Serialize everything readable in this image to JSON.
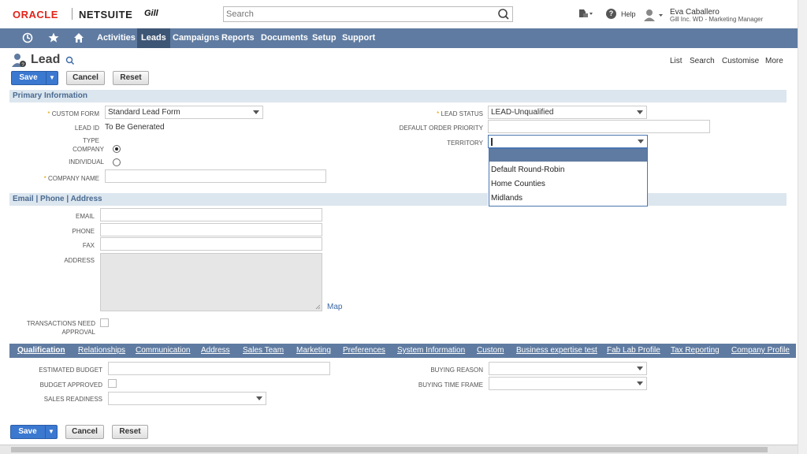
{
  "header": {
    "logo_oracle": "ORACLE",
    "logo_netsuite": "NETSUITE",
    "logo_company": "Gill",
    "search_placeholder": "Search",
    "help_label": "Help",
    "user_name": "Eva Caballero",
    "user_role": "Gill Inc. WD - Marketing Manager"
  },
  "nav": {
    "items": [
      "Activities",
      "Leads",
      "Campaigns",
      "Reports",
      "Documents",
      "Setup",
      "Support"
    ],
    "active": "Leads"
  },
  "page": {
    "title": "Lead",
    "links": [
      "List",
      "Search",
      "Customise",
      "More"
    ]
  },
  "buttons": {
    "save": "Save",
    "cancel": "Cancel",
    "reset": "Reset"
  },
  "primary": {
    "section_title": "Primary Information",
    "custom_form_label": "CUSTOM FORM",
    "custom_form_value": "Standard Lead Form",
    "lead_id_label": "LEAD ID",
    "lead_id_value": "To Be Generated",
    "type_label": "TYPE",
    "company_label": "COMPANY",
    "individual_label": "INDIVIDUAL",
    "company_name_label": "COMPANY NAME",
    "lead_status_label": "LEAD STATUS",
    "lead_status_value": "LEAD-Unqualified",
    "default_order_priority_label": "DEFAULT ORDER PRIORITY",
    "territory_label": "TERRITORY",
    "territory_options": [
      "Default Round-Robin",
      "Home Counties",
      "Midlands"
    ]
  },
  "contact": {
    "section_title": "Email | Phone | Address",
    "email_label": "EMAIL",
    "phone_label": "PHONE",
    "fax_label": "FAX",
    "address_label": "ADDRESS",
    "map_link": "Map",
    "transactions_label_1": "TRANSACTIONS NEED",
    "transactions_label_2": "APPROVAL"
  },
  "subtabs": [
    "Qualification",
    "Relationships",
    "Communication",
    "Address",
    "Sales Team",
    "Marketing",
    "Preferences",
    "System Information",
    "Custom",
    "Business expertise test",
    "Fab Lab Profile",
    "Tax Reporting",
    "Company Profile"
  ],
  "qualification": {
    "estimated_budget_label": "ESTIMATED BUDGET",
    "budget_approved_label": "BUDGET APPROVED",
    "sales_readiness_label": "SALES READINESS",
    "buying_reason_label": "BUYING REASON",
    "buying_time_frame_label": "BUYING TIME FRAME"
  },
  "colors": {
    "nav_bg": "#5f7ba1",
    "nav_active": "#3e5675",
    "section_bg": "#dce6ef",
    "save_btn": "#3b78d0",
    "oracle_red": "#e2231a"
  }
}
